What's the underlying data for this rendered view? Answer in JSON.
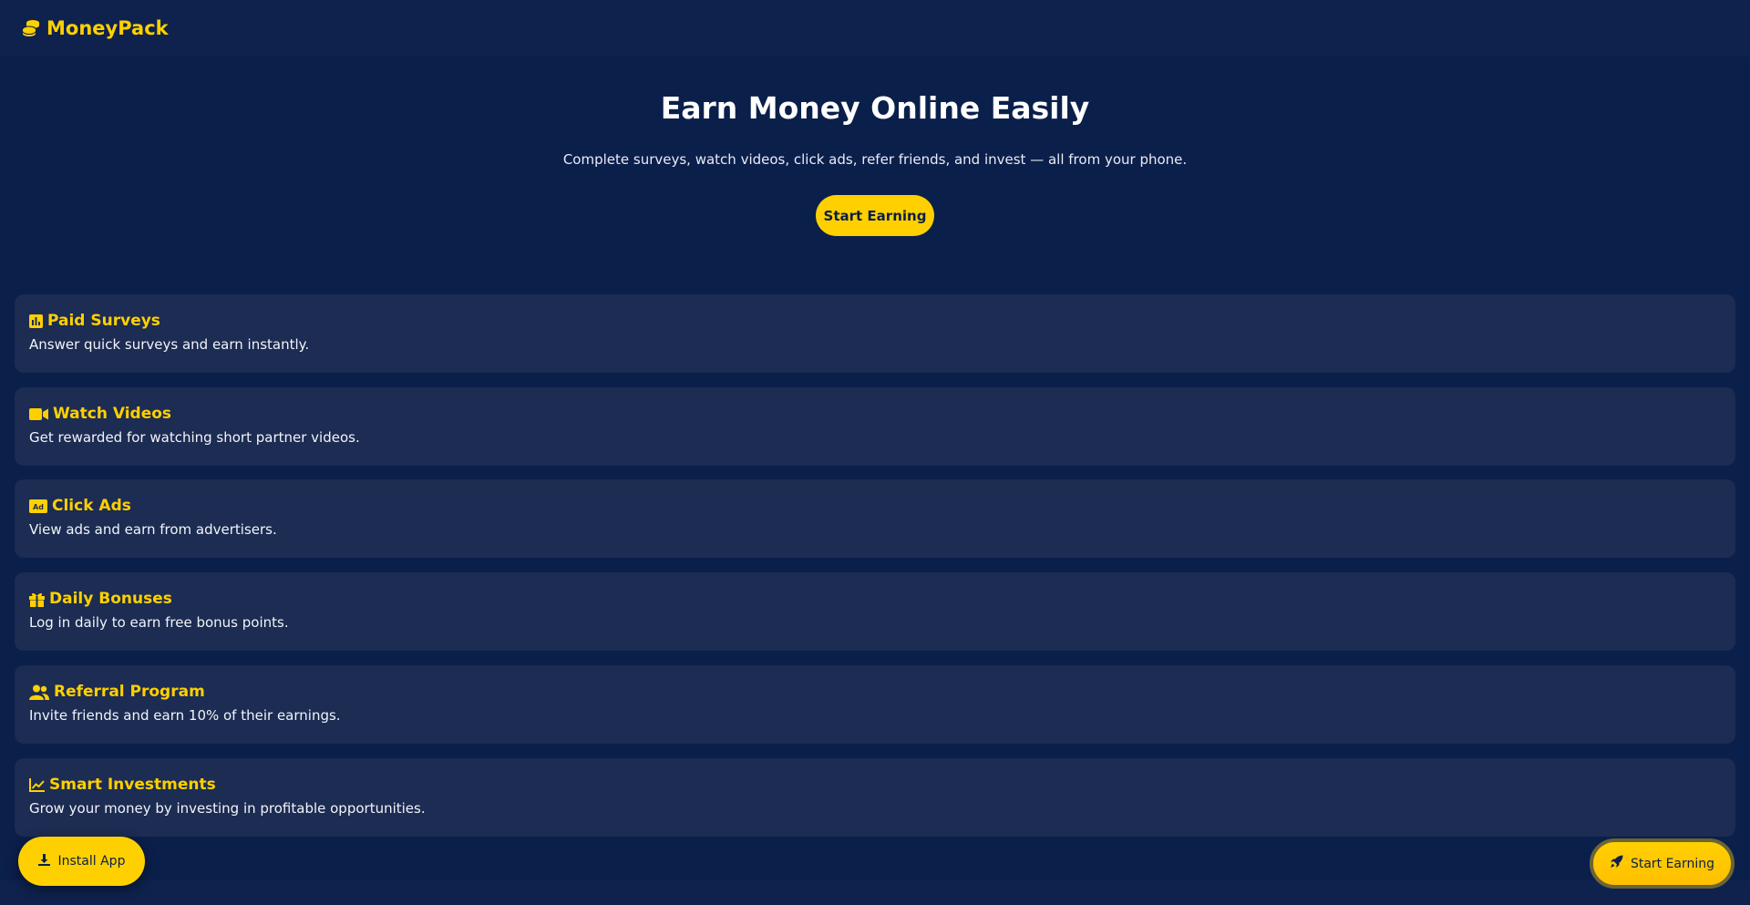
{
  "brand": {
    "name": "MoneyPack",
    "icon": "coins-icon"
  },
  "hero": {
    "title": "Earn Money Online Easily",
    "subtitle": "Complete surveys, watch videos, click ads, refer friends, and invest — all from your phone.",
    "cta_label": "Start Earning"
  },
  "features": [
    {
      "icon": "chart-bar-icon",
      "title": "Paid Surveys",
      "desc": "Answer quick surveys and earn instantly."
    },
    {
      "icon": "video-icon",
      "title": "Watch Videos",
      "desc": "Get rewarded for watching short partner videos."
    },
    {
      "icon": "ad-icon",
      "title": "Click Ads",
      "desc": "View ads and earn from advertisers."
    },
    {
      "icon": "gift-icon",
      "title": "Daily Bonuses",
      "desc": "Log in daily to earn free bonus points."
    },
    {
      "icon": "users-icon",
      "title": "Referral Program",
      "desc": "Invite friends and earn 10% of their earnings."
    },
    {
      "icon": "chart-line-icon",
      "title": "Smart Investments",
      "desc": "Grow your money by investing in profitable opportunities."
    }
  ],
  "install_button": {
    "label": "Install App",
    "icon": "download-icon"
  },
  "floating_button": {
    "label": "Start Earning",
    "icon": "rocket-icon"
  },
  "colors": {
    "background": "#0b1f4b",
    "card": "#1c2c52",
    "accent": "#ffd000"
  }
}
